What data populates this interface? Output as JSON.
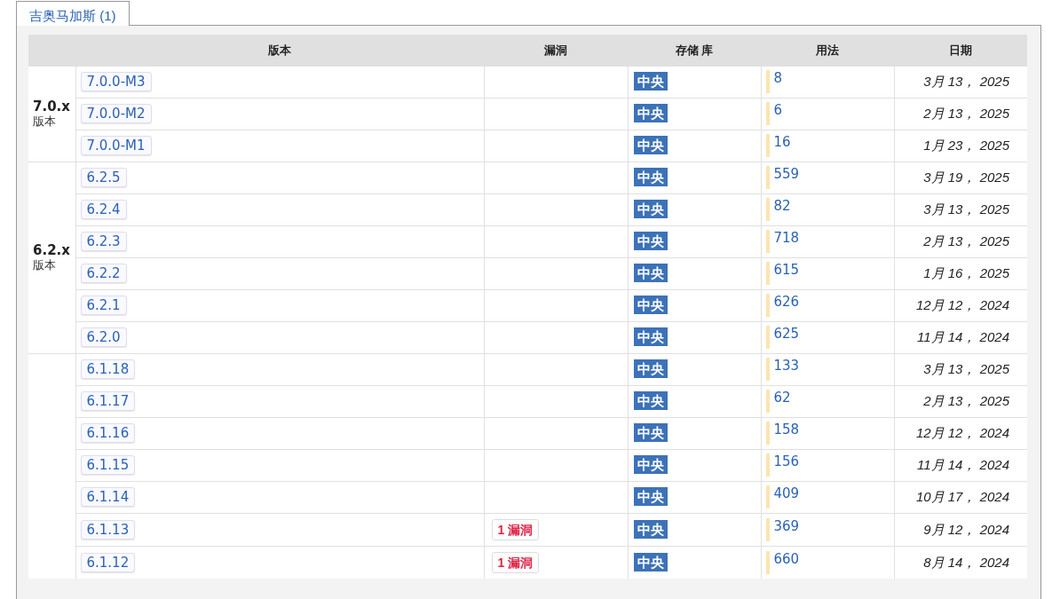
{
  "tabs": [
    {
      "label": "吉奥马加斯 (1)",
      "selected": true
    }
  ],
  "table": {
    "columns": [
      "",
      "版本",
      "漏洞",
      "存储 库",
      "用法",
      "日期"
    ],
    "groups": [
      {
        "name": "7.0.x",
        "sub": "版本",
        "rows": [
          {
            "version": "7.0.0-M3",
            "repository": "中央",
            "usage": "8",
            "date": "3月 13， 2025"
          },
          {
            "version": "7.0.0-M2",
            "repository": "中央",
            "usage": "6",
            "date": "2月 13， 2025"
          },
          {
            "version": "7.0.0-M1",
            "repository": "中央",
            "usage": "16",
            "date": "1月 23， 2025"
          }
        ]
      },
      {
        "name": "6.2.x",
        "sub": "版本",
        "rows": [
          {
            "version": "6.2.5",
            "repository": "中央",
            "usage": "559",
            "date": "3月 19， 2025"
          },
          {
            "version": "6.2.4",
            "repository": "中央",
            "usage": "82",
            "date": "3月 13， 2025"
          },
          {
            "version": "6.2.3",
            "repository": "中央",
            "usage": "718",
            "date": "2月 13， 2025"
          },
          {
            "version": "6.2.2",
            "repository": "中央",
            "usage": "615",
            "date": "1月 16， 2025"
          },
          {
            "version": "6.2.1",
            "repository": "中央",
            "usage": "626",
            "date": "12月 12， 2024"
          },
          {
            "version": "6.2.0",
            "repository": "中央",
            "usage": "625",
            "date": "11月 14， 2024"
          }
        ]
      },
      {
        "rows": [
          {
            "version": "6.1.18",
            "repository": "中央",
            "usage": "133",
            "date": "3月 13， 2025"
          },
          {
            "version": "6.1.17",
            "repository": "中央",
            "usage": "62",
            "date": "2月 13， 2025"
          },
          {
            "version": "6.1.16",
            "repository": "中央",
            "usage": "158",
            "date": "12月 12， 2024"
          },
          {
            "version": "6.1.15",
            "repository": "中央",
            "usage": "156",
            "date": "11月 14， 2024"
          },
          {
            "version": "6.1.14",
            "repository": "中央",
            "usage": "409",
            "date": "10月 17， 2024"
          },
          {
            "version": "6.1.13",
            "vulnerabilities": "1 漏洞",
            "repository": "中央",
            "usage": "369",
            "date": "9月 12， 2024"
          },
          {
            "version": "6.1.12",
            "vulnerabilities": "1 漏洞",
            "repository": "中央",
            "usage": "660",
            "date": "8月 14， 2024"
          }
        ]
      }
    ]
  }
}
